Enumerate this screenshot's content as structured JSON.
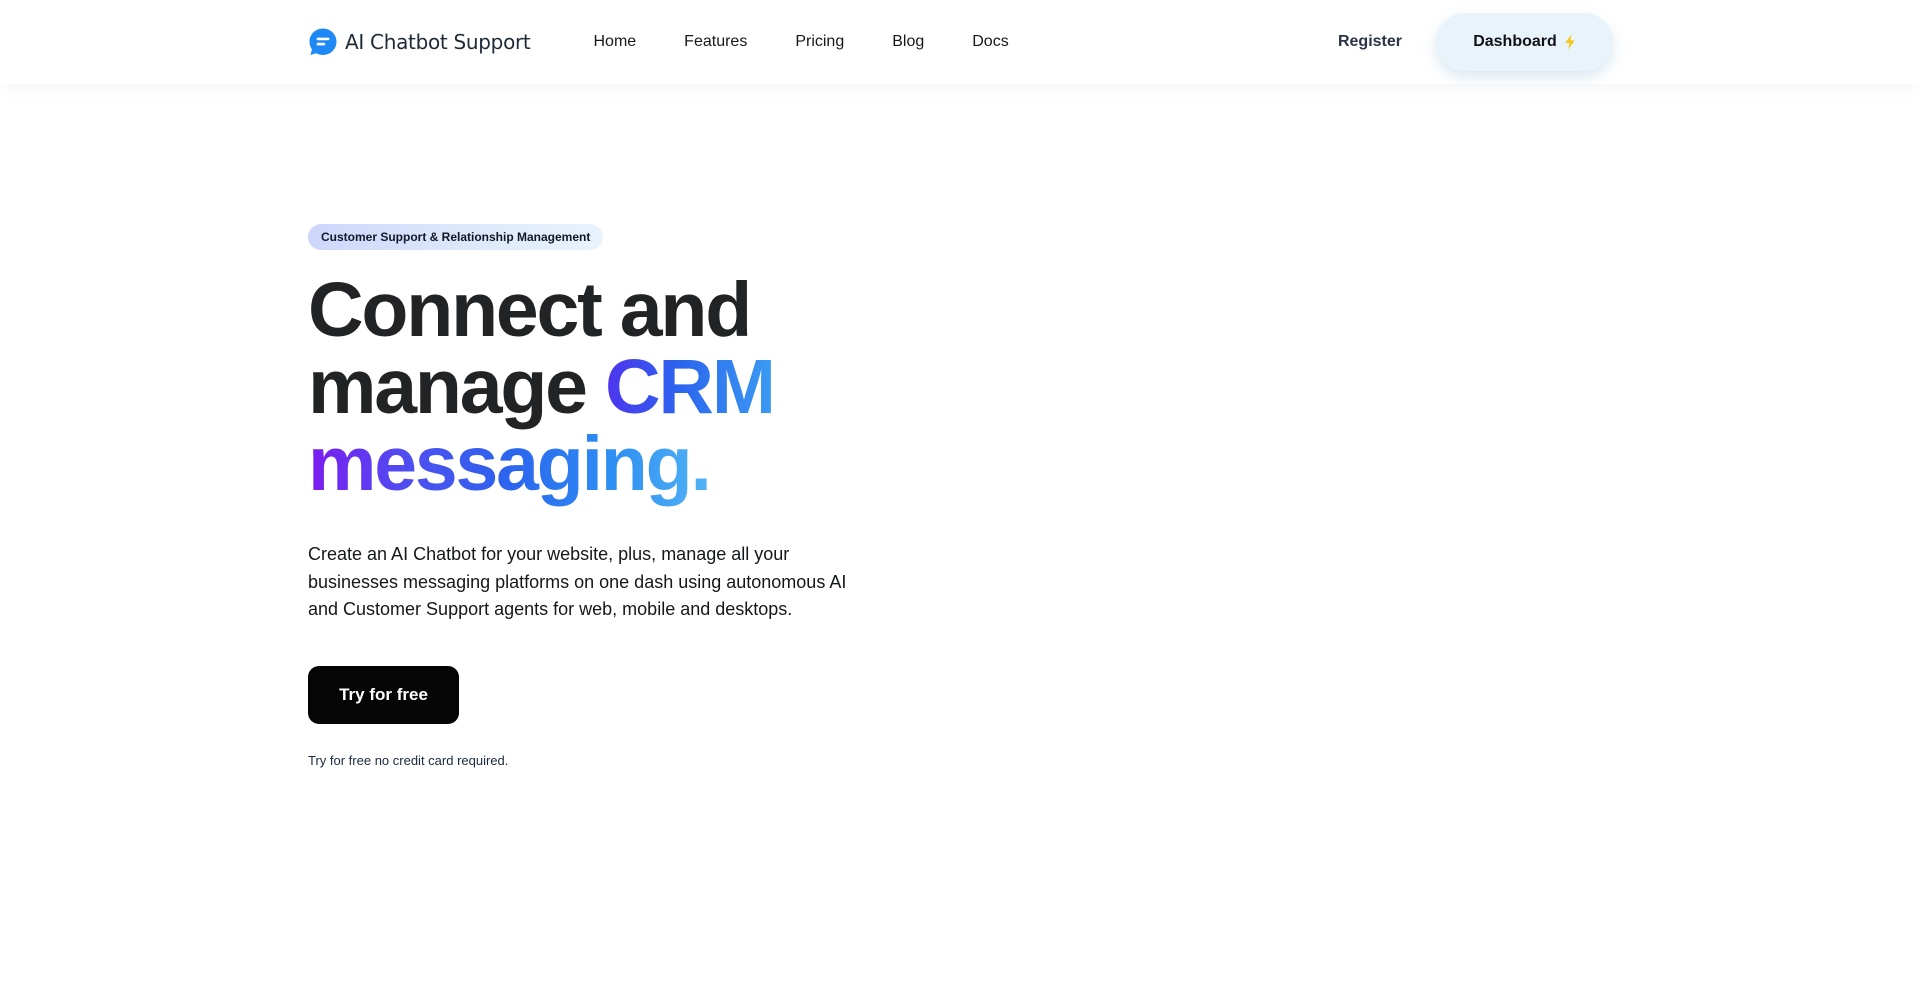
{
  "header": {
    "brand_name": "AI Chatbot Support",
    "brand_icon": "chat-bubble-icon",
    "brand_color": "#1e88f5",
    "nav_items": [
      {
        "label": "Home"
      },
      {
        "label": "Features"
      },
      {
        "label": "Pricing"
      },
      {
        "label": "Blog"
      },
      {
        "label": "Docs"
      }
    ],
    "register_label": "Register",
    "dashboard_label": "Dashboard",
    "dashboard_icon": "lightning-bolt-icon"
  },
  "hero": {
    "badge": "Customer Support & Relationship Management",
    "headline_line1": "Connect and",
    "headline_line2_plain": "manage ",
    "headline_line2_accent": "CRM",
    "headline_line3_accent": "messaging.",
    "description": "Create an AI Chatbot for your website, plus, manage all your businesses messaging platforms on one dash using autonomous AI and Customer Support agents for web, mobile and desktops.",
    "cta_label": "Try for free",
    "cta_note": "Try for free no credit card required."
  },
  "colors": {
    "gradient_start": "#7c1cf0",
    "gradient_mid": "#2c64ee",
    "gradient_end": "#52b3f4",
    "dashboard_bg": "#e8f4fa",
    "cta_bg": "#050505",
    "bolt": "#f5c518"
  }
}
